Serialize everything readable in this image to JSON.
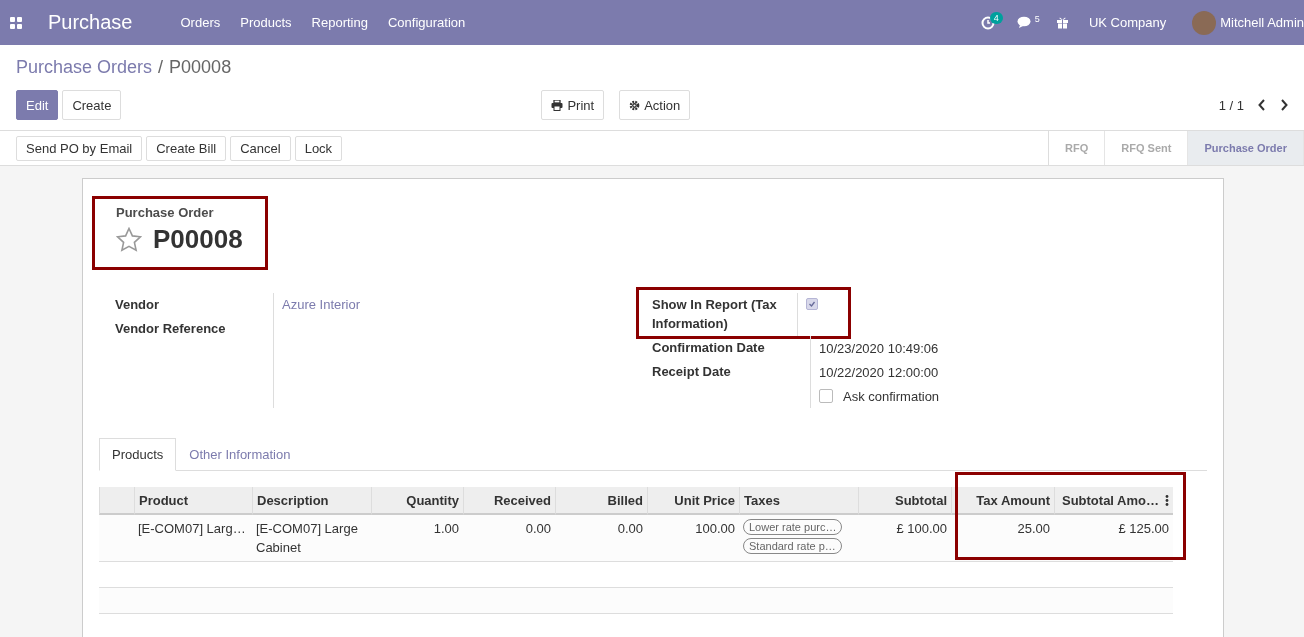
{
  "navbar": {
    "app_title": "Purchase",
    "menu": [
      "Orders",
      "Products",
      "Reporting",
      "Configuration"
    ],
    "activity_count": "4",
    "message_count": "5",
    "company": "UK Company",
    "user": "Mitchell Admin"
  },
  "breadcrumb": {
    "parent": "Purchase Orders",
    "separator": "/",
    "current": "P00008"
  },
  "control_buttons": {
    "primary": "Edit",
    "secondary": "Create",
    "print": "Print",
    "action": "Action",
    "pager": "1 / 1"
  },
  "status_buttons": [
    "Send PO by Email",
    "Create Bill",
    "Cancel",
    "Lock"
  ],
  "stages": [
    {
      "label": "RFQ",
      "selected": false
    },
    {
      "label": "RFQ Sent",
      "selected": false
    },
    {
      "label": "Purchase Order",
      "selected": true
    }
  ],
  "form": {
    "subtitle": "Purchase Order",
    "name": "P00008",
    "starred": false,
    "left_fields": [
      {
        "label": "Vendor",
        "value": "Azure Interior",
        "kind": "link"
      },
      {
        "label": "Vendor Reference",
        "kind": "text"
      }
    ],
    "show_in_report": {
      "label": "Show In Report (Tax Information)",
      "checked": true
    },
    "right_fields": [
      {
        "label": "Confirmation Date",
        "value": "10/23/2020 10:49:06"
      },
      {
        "label": "Receipt Date",
        "value": "10/22/2020 12:00:00"
      }
    ],
    "ask_confirmation": {
      "label": "Ask confirmation",
      "checked": false
    }
  },
  "tabs": [
    {
      "label": "Products",
      "selected": true
    },
    {
      "label": "Other Information",
      "selected": false
    }
  ],
  "table": {
    "columns": [
      "Product",
      "Description",
      "Quantity",
      "Received",
      "Billed",
      "Unit Price",
      "Taxes",
      "Subtotal",
      "Tax Amount",
      "Subtotal Amo…"
    ],
    "rows": [
      {
        "cells": [
          "[E-COM07] Larg…",
          "[E-COM07] Large Cabinet",
          "1.00",
          "0.00",
          "0.00",
          "100.00",
          null,
          "£ 100.00",
          "25.00",
          "£ 125.00"
        ],
        "taxes": [
          "Lower rate purc…",
          "Standard rate p…"
        ]
      }
    ]
  }
}
